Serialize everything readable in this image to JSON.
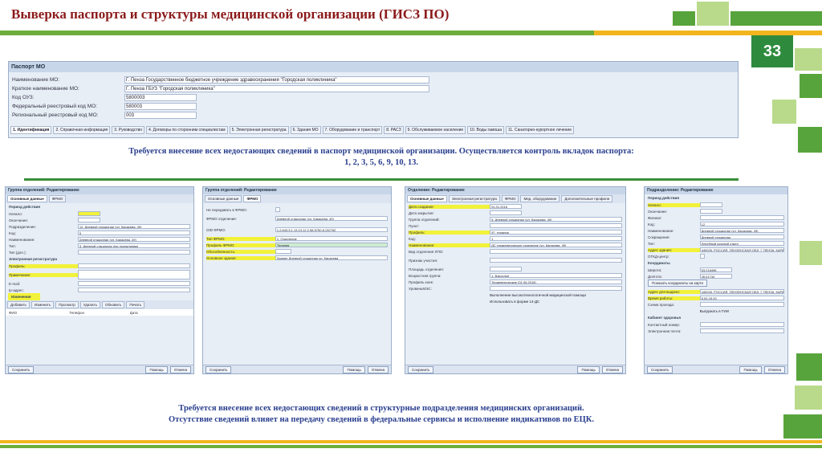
{
  "header": {
    "title": "Выверка паспорта и структуры медицинской организации (ГИСЗ ПО)",
    "page_number": "33"
  },
  "passport": {
    "title": "Паспорт МО",
    "fields": [
      {
        "label": "Наименование МО:",
        "value": "Г. Пенза Государственное бюджетное учреждение здравоохранения \"Городская поликлиника\""
      },
      {
        "label": "Краткое наименование МО:",
        "value": "Г. Пенза ГБУЗ \"Городская поликлиника\""
      },
      {
        "label": "Код ОУЗ:",
        "value": "5800003"
      },
      {
        "label": "Федеральный реестровый код МО:",
        "value": "580003"
      },
      {
        "label": "Региональный реестровый код МО:",
        "value": "003"
      }
    ],
    "tabs": [
      "1. Идентификация",
      "2. Справочная информация",
      "3. Руководство",
      "4. Договоры по сторонним специалистам",
      "5. Электронная регистратура",
      "6. Здания МО",
      "7. Оборудование и транспорт",
      "8. РАСЗ",
      "9. Обслуживаемое население",
      "10. Воды гамоша",
      "11. Санаторно-курортное лечение"
    ]
  },
  "note1": {
    "line1": "Требуется внесение всех недостающих сведений в паспорт медицинской организации. Осуществляется контроль вкладок паспорта:",
    "line2": "1, 2, 3, 5, 6, 9, 10, 13."
  },
  "note2": {
    "line1": "Требуется внесение всех недостающих сведений в структурные подразделения медицинских организаций.",
    "line2": "Отсутствие сведений влияет на передачу сведений в федеральные сервисы и исполнение индикативов по ЕЦК."
  },
  "panel1": {
    "title": "Группа отделений: Редактирование",
    "tabs": [
      "Основные данные",
      "ФРМО"
    ],
    "section1": "Период действия",
    "rows": [
      {
        "label": "Начало:",
        "value": ""
      },
      {
        "label": "Окончание:",
        "value": ""
      },
      {
        "label": "Подразделение:",
        "value": "12. Дневной стационар (ул. Карасева, 49)"
      },
      {
        "label": "Код:",
        "value": "5"
      },
      {
        "label": "Наименование:",
        "value": "Дневной стационар (ул. Карасева, 49)"
      },
      {
        "label": "Тип:",
        "value": "3. Дневной стационар при поликлинике"
      },
      {
        "label": "Тип (доп.):",
        "value": ""
      }
    ],
    "section2": "Электронная регистратура",
    "rows2": [
      {
        "label": "Профиль:",
        "value": ""
      },
      {
        "label": "Примечание:",
        "value": ""
      },
      {
        "label": "E-mail:",
        "value": ""
      },
      {
        "label": "Ip-адрес:",
        "value": ""
      }
    ],
    "section3": "Изменения",
    "tools": [
      "Добавить",
      "Изменить",
      "Просмотр",
      "Удалить",
      "Обновить",
      "Печать"
    ],
    "cols": [
      "ФИО",
      "Телефон",
      "Дата"
    ],
    "save": "Сохранить",
    "help": "Помощь",
    "cancel": "Отмена"
  },
  "panel2": {
    "title": "Группа отделений: Редактирование",
    "tabs": [
      "Основные данные",
      "ФРМО"
    ],
    "rows": [
      {
        "label": "Не передавать в ФРМО:",
        "value": ""
      },
      {
        "label": "ФРМО отделение:",
        "value": "Дневной стационар (ул. Карасева, 49)"
      },
      {
        "label": "OID ФРМО:",
        "value": "1.2.643.5.1.13.13.12.2.58.5750.8.132762"
      },
      {
        "label": "Тип ФРМО:",
        "value": "1. Отделение"
      },
      {
        "label": "Профиль ФРМО:",
        "value": "Терапия"
      },
      {
        "label": "Обособленность:",
        "value": ""
      },
      {
        "label": "Основное здание:",
        "value": "Здание Дневной стационар ул. Карасева"
      }
    ],
    "save": "Сохранить",
    "help": "Помощь",
    "cancel": "Отмена"
  },
  "panel3": {
    "title": "Отделение: Редактирование",
    "tabs": [
      "Основные данные",
      "Электронная регистратура",
      "ФРМО",
      "Мед. оборудование",
      "Дополнительные профили"
    ],
    "rows": [
      {
        "label": "Дата создания:",
        "value": "01.01.2016"
      },
      {
        "label": "Дата закрытия:",
        "value": ""
      },
      {
        "label": "Группа отделений:",
        "value": "5. Дневной стационар (ул. Карасева, 49)"
      },
      {
        "label": "Пункт:",
        "value": ""
      },
      {
        "label": "Профиль:",
        "value": "97. терапия"
      },
      {
        "label": "Код:",
        "value": "1"
      },
      {
        "label": "Наименование:",
        "value": "ДС терапевтическое отделение (ул. Карасева, 49)"
      },
      {
        "label": "Вид отделения ЛПО:",
        "value": ""
      },
      {
        "label": "Признак участия:",
        "value": ""
      },
      {
        "label": "Площадь отделения:",
        "value": ""
      },
      {
        "label": "Возрастная группа:",
        "value": "1. Взрослое"
      },
      {
        "label": "Профиль коек:",
        "value": "Терапевтические (01.06.2018)"
      },
      {
        "label": "УровеньМЭС:",
        "value": ""
      }
    ],
    "check1": "Выполнение высокотехнологичной медицинской помощи",
    "check2": "Использовать в форме 14-ДС",
    "save": "Сохранить",
    "help": "Помощь",
    "cancel": "Отмена"
  },
  "panel4": {
    "title": "Подразделение: Редактирование",
    "section1": "Период действия",
    "rows": [
      {
        "label": "Начало:",
        "value": ""
      },
      {
        "label": "Окончание:",
        "value": ""
      },
      {
        "label": "Филиал:",
        "value": ""
      },
      {
        "label": "Код:",
        "value": "12"
      },
      {
        "label": "Наименование:",
        "value": "Дневной стационар (ул. Карасева, 49)"
      },
      {
        "label": "Сокращение:",
        "value": "Дневной стационар"
      },
      {
        "label": "Тип:",
        "value": "Лечебный кочевой отдел"
      },
      {
        "label": "Адрес здания:",
        "value": "440026, РОССИЯ, ПЕНЗЕНСКАЯ ОБЛ, Г ПЕНЗА, КАРАКОЗОВА"
      },
      {
        "label": "ОТКД-центр:",
        "value": ""
      }
    ],
    "section2": "Координаты",
    "rows2": [
      {
        "label": "Широта:",
        "value": "53.218498"
      },
      {
        "label": "Долгота:",
        "value": "45.01744"
      }
    ],
    "coord_btn": "Показать координаты на карте",
    "rows3": [
      {
        "label": "Адрес для выдачи:",
        "value": "440026, РОССИЯ, ПЕНЗЕНСКАЯ ОБЛ, Г ПЕНЗА, КАРАКОЗОВА"
      },
      {
        "label": "Время работы:",
        "value": "8.00-15.00"
      },
      {
        "label": "Схема проезда:",
        "value": ""
      }
    ],
    "check": "Выгружать в ГИИ",
    "section3": "Кабинет здоровья",
    "rows4": [
      {
        "label": "Контактный номер:",
        "value": ""
      },
      {
        "label": "Электронная почта:",
        "value": ""
      }
    ],
    "save": "Сохранить",
    "help": "Помощь",
    "cancel": "Отмена"
  }
}
